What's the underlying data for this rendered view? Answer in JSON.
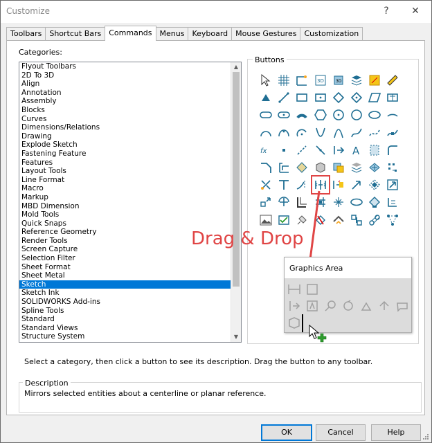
{
  "window": {
    "title": "Customize",
    "help_glyph": "?",
    "close_glyph": "✕"
  },
  "tabs": [
    "Toolbars",
    "Shortcut Bars",
    "Commands",
    "Menus",
    "Keyboard",
    "Mouse Gestures",
    "Customization"
  ],
  "active_tab": "Commands",
  "categories": {
    "label": "Categories:",
    "items": [
      "Flyout Toolbars",
      "2D To 3D",
      "Align",
      "Annotation",
      "Assembly",
      "Blocks",
      "Curves",
      "Dimensions/Relations",
      "Drawing",
      "Explode Sketch",
      "Fastening Feature",
      "Features",
      "Layout Tools",
      "Line Format",
      "Macro",
      "Markup",
      "MBD Dimension",
      "Mold Tools",
      "Quick Snaps",
      "Reference Geometry",
      "Render Tools",
      "Screen Capture",
      "Selection Filter",
      "Sheet Format",
      "Sheet Metal",
      "Sketch",
      "Sketch Ink",
      "SOLIDWORKS Add-ins",
      "Spline Tools",
      "Standard",
      "Standard Views",
      "Structure System"
    ],
    "selected": "Sketch"
  },
  "buttons": {
    "label": "Buttons",
    "icons": [
      "select-arrow-icon",
      "grid-icon",
      "sketch-icon",
      "3d-sketch-icon",
      "3d-sketch-plane-icon",
      "layers-icon",
      "rapid-sketch-icon",
      "ruler-icon",
      "point-icon",
      "line-icon",
      "corner-rectangle-icon",
      "center-rectangle-icon",
      "3-point-rectangle-icon",
      "parallelogram-icon",
      "slot-icon",
      "polygon-icon",
      "straight-slot-icon",
      "centerpoint-slot-icon",
      "arc-slot-icon",
      "hexagon-icon",
      "circle-icon",
      "perimeter-circle-icon",
      "ellipse-icon",
      "partial-ellipse-icon",
      "tangent-arc-icon",
      "3-point-arc-icon",
      "centerpoint-arc-icon",
      "parabola-icon",
      "conic-icon",
      "spline-icon",
      "style-spline-icon",
      "fit-spline-icon",
      "equation-curve-icon",
      "sketch-point-icon",
      "centerline-icon",
      "midpoint-line-icon",
      "offset-icon",
      "text-icon",
      "plane-icon",
      "fillet-icon",
      "chamfer-icon",
      "offset-entities-icon",
      "convert-entities-icon",
      "intersection-curve-icon",
      "face-curves-icon",
      "segment-icon",
      "surface-icon",
      "pattern-icon",
      "trim-icon",
      "extend-icon",
      "split-icon",
      "mirror-entities-icon",
      "dynamic-mirror-icon",
      "move-icon",
      "copy-icon",
      "scale-icon",
      "rotate-icon",
      "stretch-icon",
      "linear-pattern-icon",
      "circular-pattern-icon",
      "jog-line-icon",
      "make-path-icon",
      "modify-icon",
      "relations-icon",
      "sketch-picture-icon",
      "check-sketch-icon",
      "repair-sketch-icon",
      "block-icon",
      "shaded-sketch-icon",
      "fully-define-icon",
      "display-relations-icon",
      "belt-icon"
    ],
    "highlighted": "mirror-entities-icon"
  },
  "hint": "Select a category, then click a button to see its description. Drag the button to any toolbar.",
  "description": {
    "label": "Description",
    "text": "Mirrors selected entities about a centerline or planar reference."
  },
  "actions": {
    "ok": "OK",
    "cancel": "Cancel",
    "help": "Help"
  },
  "overlay": {
    "callout": "Drag & Drop",
    "graphics_area_title": "Graphics Area",
    "callout_color": "#e04545",
    "accent_color": "#0078d7",
    "icon_color": "#1f6e93"
  }
}
